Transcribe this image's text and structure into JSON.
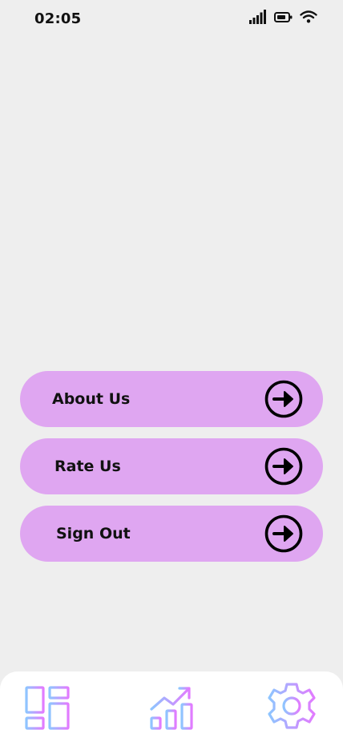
{
  "status_bar": {
    "time": "02:05",
    "icons": [
      "signal-icon",
      "battery-icon",
      "wifi-icon"
    ]
  },
  "menu": {
    "items": [
      {
        "label": "About Us",
        "icon": "arrow-right-circle-icon"
      },
      {
        "label": "Rate Us",
        "icon": "arrow-right-circle-icon"
      },
      {
        "label": "Sign Out",
        "icon": "arrow-right-circle-icon"
      }
    ]
  },
  "bottom_nav": {
    "items": [
      {
        "icon": "dashboard-icon"
      },
      {
        "icon": "analytics-icon"
      },
      {
        "icon": "settings-gear-icon",
        "active": true
      }
    ]
  },
  "colors": {
    "background": "#eeeeee",
    "menu_item": "#dfa6f1",
    "nav_background": "#ffffff",
    "icon_gradient_start": "#8ec5ff",
    "icon_gradient_end": "#e27bff"
  }
}
